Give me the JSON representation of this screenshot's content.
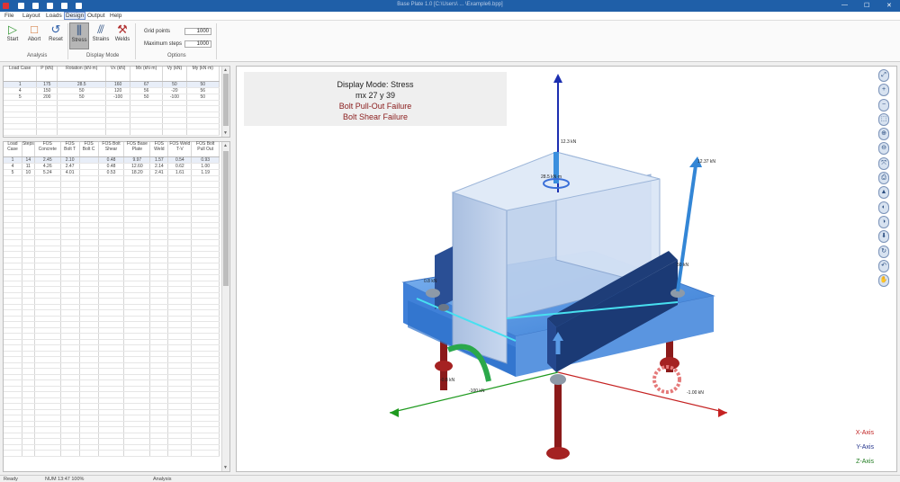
{
  "window": {
    "title": "Base Plate 1.0 [C:\\Users\\ ... \\Example6.bpp]",
    "minimize_glyph": "—",
    "maximize_glyph": "☐",
    "close_glyph": "✕"
  },
  "menu": [
    "File",
    "Layout",
    "Loads",
    "Design",
    "Output",
    "Help"
  ],
  "ribbon": {
    "analysis": {
      "label": "Analysis",
      "buttons": [
        "Start",
        "Abort",
        "Reset"
      ]
    },
    "display_mode": {
      "label": "Display Mode",
      "buttons": [
        "Stress",
        "Strains",
        "Welds"
      ]
    },
    "options": {
      "label": "Options",
      "grid_points_label": "Grid points",
      "grid_points_value": "1000",
      "max_steps_label": "Maximum steps",
      "max_steps_value": "1000"
    }
  },
  "loads_table": {
    "headers": [
      "Load Case",
      "P (kN)",
      "Rotation (kN·m)",
      "Vx (kN)",
      "Mx (kN·m)",
      "Vy (kN)",
      "My (kN·m)"
    ],
    "rows": [
      [
        "1",
        "175",
        "28.5",
        "160",
        "67",
        "50",
        "50"
      ],
      [
        "4",
        "150",
        "50",
        "120",
        "56",
        "-20",
        "56"
      ],
      [
        "5",
        "200",
        "50",
        "-100",
        "50",
        "-100",
        "50"
      ]
    ]
  },
  "results_table": {
    "headers": [
      "Load Case",
      "Steps",
      "FOS Concrete",
      "FOS Bolt T",
      "FOS Bolt C",
      "FOS Bolt Shear",
      "FOS Base Plate",
      "FOS Weld",
      "FOS Weld T-V",
      "FOS Bolt Pull Out"
    ],
    "rows": [
      [
        "1",
        "14",
        "2.45",
        "2.10",
        "",
        "0.48",
        "9.97",
        "1.57",
        "0.54",
        "0.93"
      ],
      [
        "4",
        "11",
        "4.26",
        "2.47",
        "",
        "0.48",
        "12.60",
        "2.14",
        "0.62",
        "1.00"
      ],
      [
        "5",
        "10",
        "5.24",
        "4.01",
        "",
        "0.53",
        "18.20",
        "2.41",
        "1.61",
        "1.19"
      ]
    ]
  },
  "viewport": {
    "display_mode_line": "Display Mode: Stress",
    "coords_line": "mx 27  y 39",
    "failure_1": "Bolt Pull-Out Failure",
    "failure_2": "Bolt Shear Failure",
    "labels": {
      "force_top": "12.3 kN",
      "force_right": "12.37 kN",
      "torque_top": "28.5 kN·m",
      "left_value": "0.8 kN",
      "bottom_left": "-0.8 kN",
      "bottom_mid": "-100 kN",
      "right_value": "-1.00 kN",
      "right_small": "50 kN"
    },
    "legend": {
      "x": "X-Axis",
      "y": "Y-Axis",
      "z": "Z-Axis",
      "x_color": "#c02020",
      "y_color": "#20308a",
      "z_color": "#1d7a1d"
    }
  },
  "tool_icons": [
    "zoom-fit-icon",
    "zoom-in-icon",
    "zoom-out-icon",
    "zoom-window-icon",
    "zoom-plus-icon",
    "zoom-minus-icon",
    "zoom-extents-icon",
    "print-icon",
    "rotate-up-icon",
    "rotate-left-icon",
    "rotate-right-icon",
    "rotate-down-icon",
    "spin-icon",
    "undo-view-icon",
    "pan-icon"
  ],
  "status": {
    "left": "Ready",
    "middle": "NUM  13:47  100%",
    "right": "Analysis"
  }
}
